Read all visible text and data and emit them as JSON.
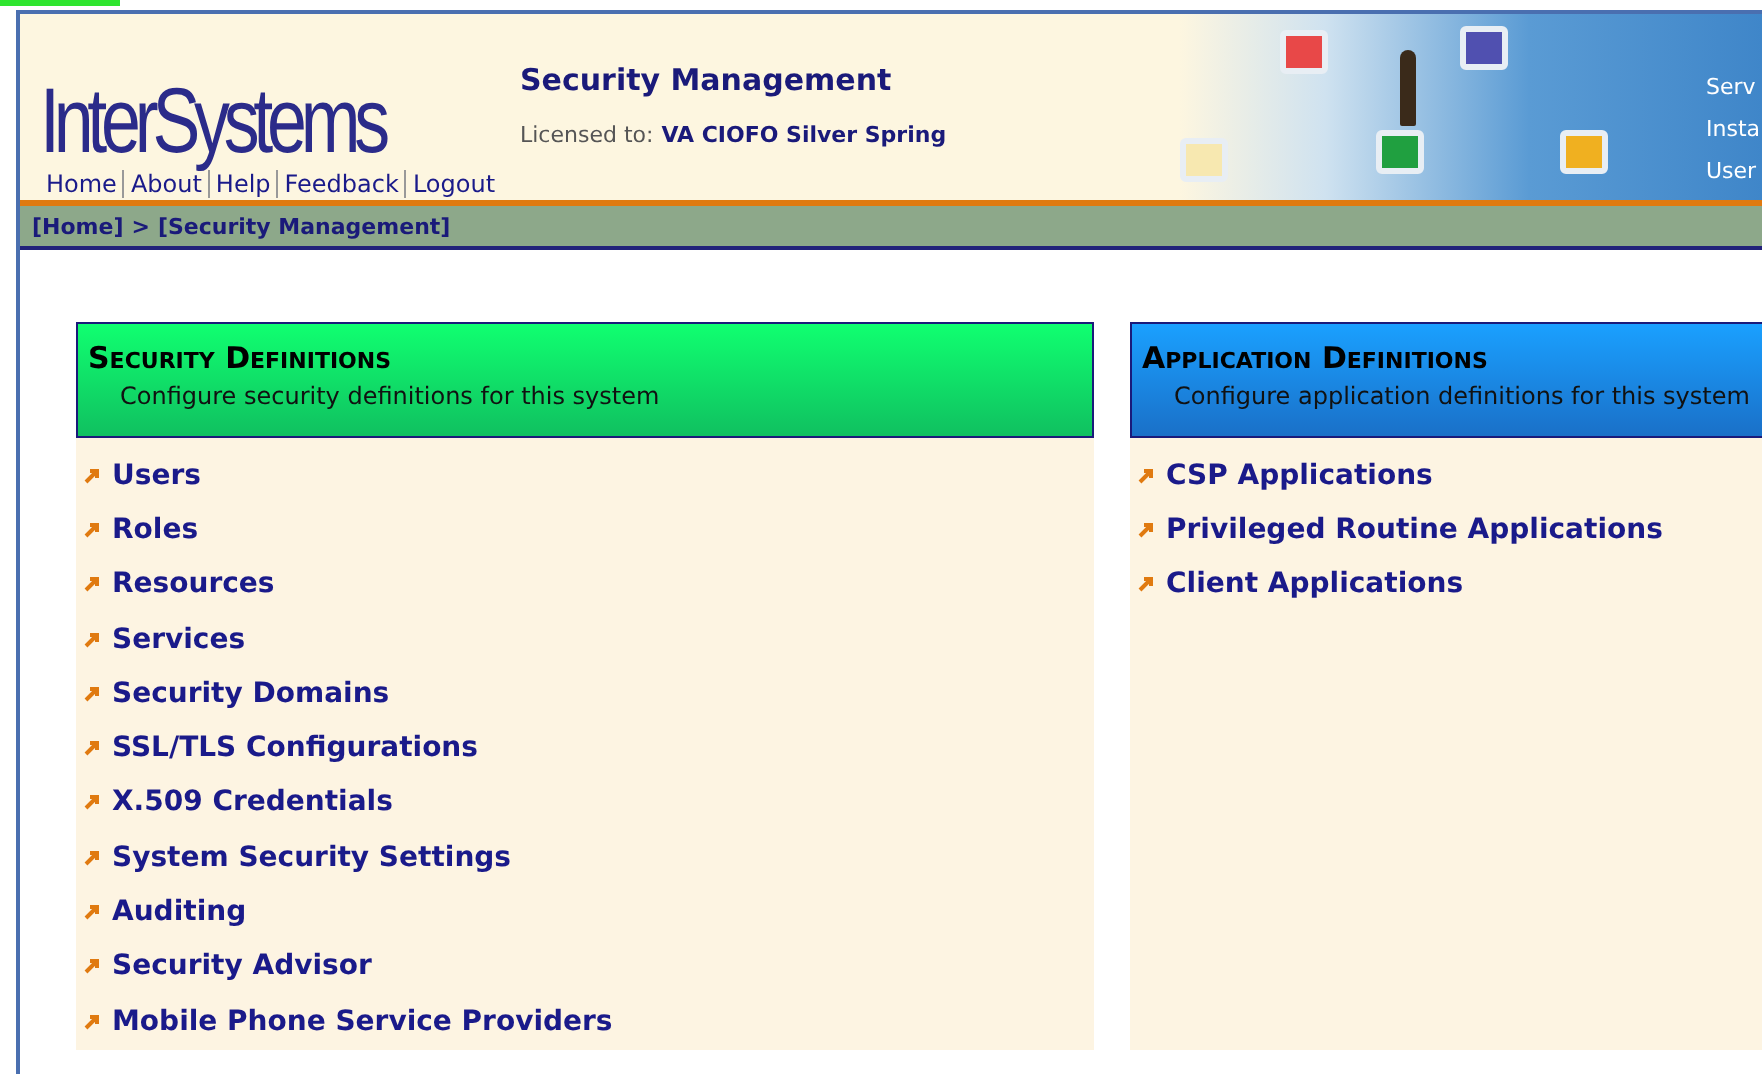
{
  "header": {
    "logo": "InterSystems",
    "title": "Security Management",
    "license_label": "Licensed to:",
    "license_value": "VA CIOFO Silver Spring",
    "nav_links": [
      "Home",
      "About",
      "Help",
      "Feedback",
      "Logout"
    ],
    "info_labels": [
      "Serv",
      "Insta",
      "User"
    ]
  },
  "breadcrumb": [
    "[Home]",
    ">",
    "[Security Management]"
  ],
  "panels": [
    {
      "kind": "security",
      "title": "Security Definitions",
      "subtitle": "Configure security definitions for this system",
      "links": [
        "Users",
        "Roles",
        "Resources",
        "Services",
        "Security Domains",
        "SSL/TLS Configurations",
        "X.509 Credentials",
        "System Security Settings",
        "Auditing",
        "Security Advisor",
        "Mobile Phone Service Providers"
      ]
    },
    {
      "kind": "application",
      "title": "Application Definitions",
      "subtitle": "Configure application definitions for this system",
      "links": [
        "CSP Applications",
        "Privileged Routine Applications",
        "Client Applications"
      ]
    }
  ]
}
